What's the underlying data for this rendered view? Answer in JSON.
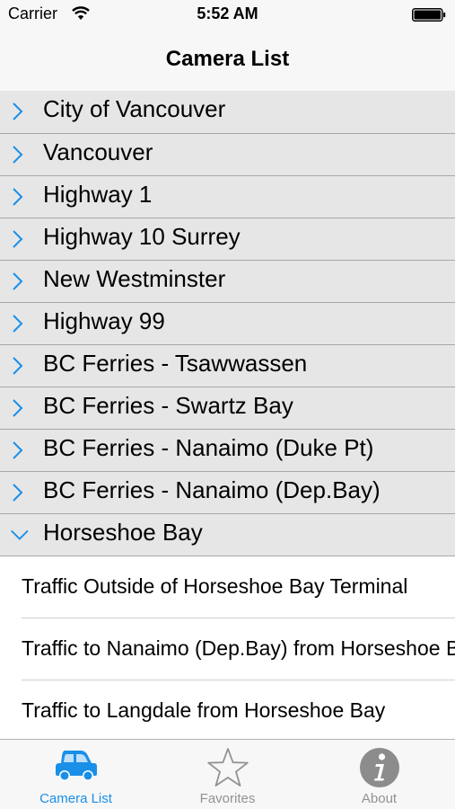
{
  "status_bar": {
    "carrier": "Carrier",
    "time": "5:52 AM"
  },
  "nav": {
    "title": "Camera List"
  },
  "colors": {
    "accent": "#1a8fe8",
    "section_bg": "#e6e6e6",
    "tab_inactive": "#929292"
  },
  "sections": [
    {
      "label": "City of Vancouver",
      "expanded": false
    },
    {
      "label": "Vancouver",
      "expanded": false
    },
    {
      "label": "Highway 1",
      "expanded": false
    },
    {
      "label": "Highway 10 Surrey",
      "expanded": false
    },
    {
      "label": "New Westminster",
      "expanded": false
    },
    {
      "label": "Highway 99",
      "expanded": false
    },
    {
      "label": "BC Ferries - Tsawwassen",
      "expanded": false
    },
    {
      "label": "BC Ferries - Swartz Bay",
      "expanded": false
    },
    {
      "label": "BC Ferries - Nanaimo (Duke Pt)",
      "expanded": false
    },
    {
      "label": "BC Ferries - Nanaimo (Dep.Bay)",
      "expanded": false
    },
    {
      "label": "Horseshoe Bay",
      "expanded": true
    }
  ],
  "cameras": [
    {
      "label": "Traffic Outside of Horseshoe Bay Terminal"
    },
    {
      "label": "Traffic to Nanaimo (Dep.Bay) from Horseshoe Bay"
    },
    {
      "label": "Traffic to Langdale from Horseshoe Bay"
    }
  ],
  "tabs": [
    {
      "label": "Camera List",
      "icon": "car-icon",
      "active": true
    },
    {
      "label": "Favorites",
      "icon": "star-icon",
      "active": false
    },
    {
      "label": "About",
      "icon": "info-icon",
      "active": false
    }
  ]
}
